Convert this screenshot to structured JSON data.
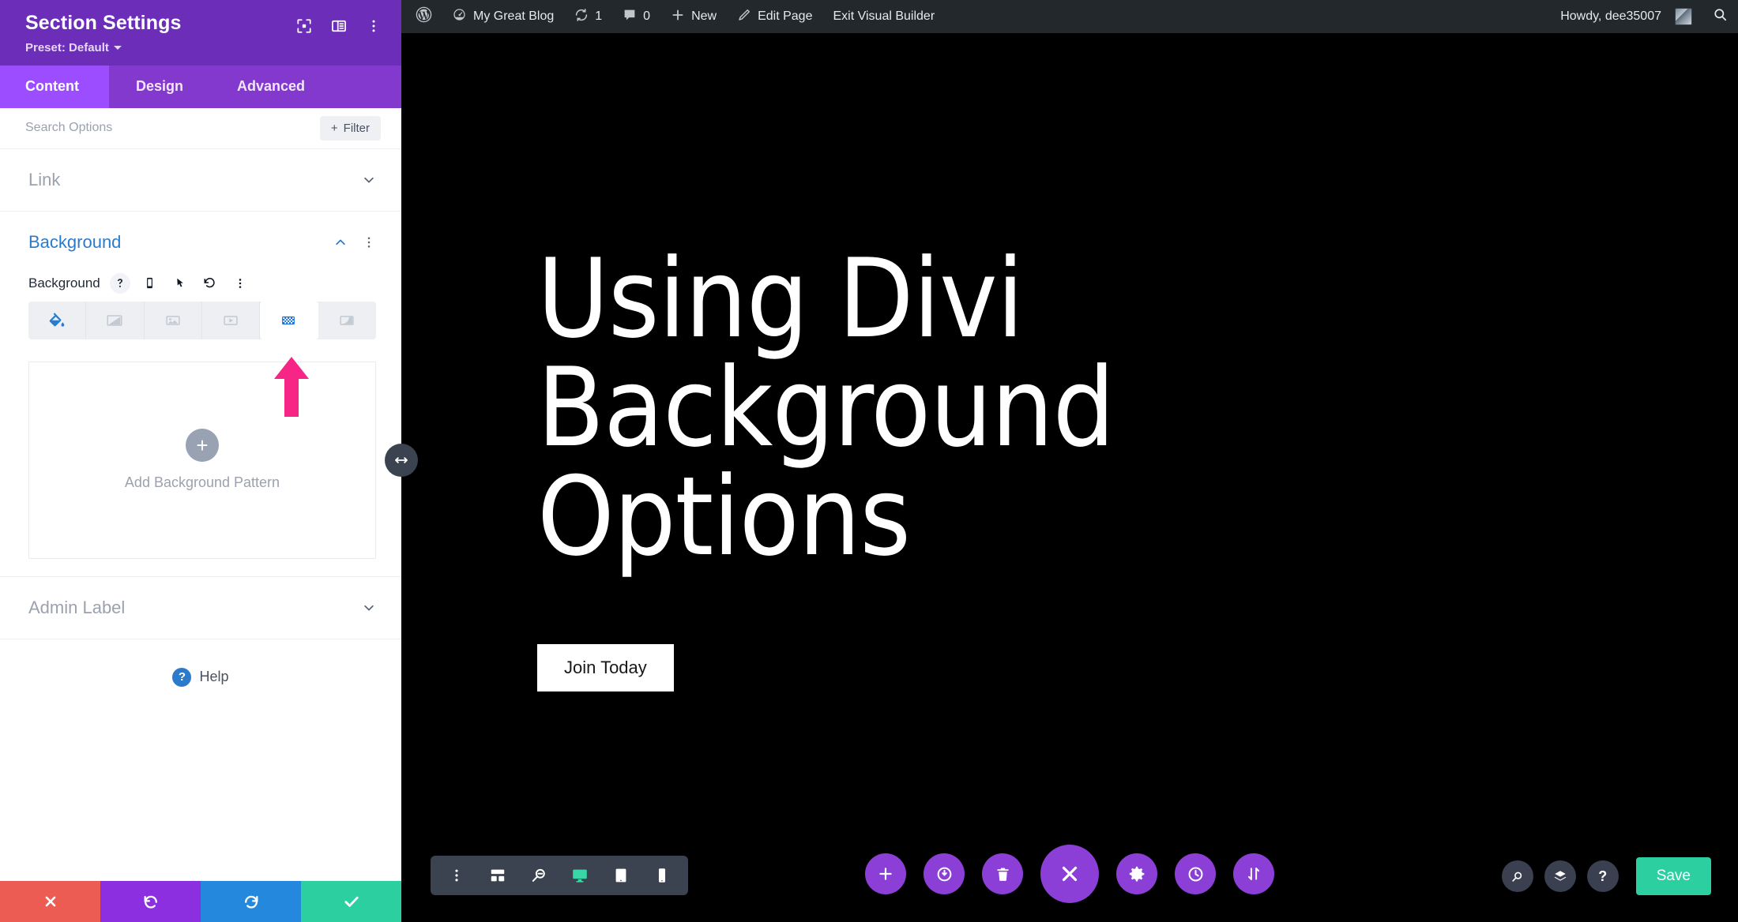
{
  "settings_panel": {
    "title": "Section Settings",
    "preset_label": "Preset: Default",
    "header_icons": [
      {
        "name": "focus-icon",
        "label": "Focus"
      },
      {
        "name": "layout-panel-icon",
        "label": "Panel Layout"
      },
      {
        "name": "more-vertical-icon",
        "label": "More Options"
      }
    ],
    "tabs": [
      {
        "label": "Content",
        "active": true
      },
      {
        "label": "Design",
        "active": false
      },
      {
        "label": "Advanced",
        "active": false
      }
    ],
    "search": {
      "placeholder": "Search Options",
      "value": ""
    },
    "filter_button": "Filter",
    "groups": [
      {
        "label": "Link",
        "open": false
      },
      {
        "label": "Background",
        "open": true
      },
      {
        "label": "Admin Label",
        "open": false
      }
    ],
    "background_field": {
      "label": "Background",
      "control_icons": [
        "help-icon",
        "mobile-icon",
        "cursor-icon",
        "reset-icon",
        "more-vertical-icon"
      ],
      "types": [
        {
          "name": "background-color-icon",
          "label": "Background Color",
          "active": false,
          "highlighted": true
        },
        {
          "name": "background-gradient-icon",
          "label": "Background Gradient",
          "active": false,
          "highlighted": false
        },
        {
          "name": "background-image-icon",
          "label": "Background Image",
          "active": false,
          "highlighted": false
        },
        {
          "name": "background-video-icon",
          "label": "Background Video",
          "active": false,
          "highlighted": false
        },
        {
          "name": "background-pattern-icon",
          "label": "Background Pattern",
          "active": true,
          "highlighted": false
        },
        {
          "name": "background-mask-icon",
          "label": "Background Mask",
          "active": false,
          "highlighted": false
        }
      ],
      "dropzone_label": "Add Background Pattern"
    },
    "help": {
      "label": "Help"
    },
    "actions": [
      {
        "name": "cancel-button",
        "icon": "close-icon",
        "color": "#EC5C52"
      },
      {
        "name": "undo-button",
        "icon": "undo-icon",
        "color": "#8B2FE0"
      },
      {
        "name": "redo-button",
        "icon": "redo-icon",
        "color": "#2489DC"
      },
      {
        "name": "save-changes-button",
        "icon": "check-icon",
        "color": "#2CCFA0"
      }
    ]
  },
  "admin_bar": {
    "site_name": "My Great Blog",
    "updates_count": "1",
    "comments_count": "0",
    "new_label": "New",
    "edit_page_label": "Edit Page",
    "exit_builder_label": "Exit Visual Builder",
    "greeting": "Howdy, dee35007"
  },
  "canvas": {
    "heading": "Using Divi Background Options",
    "cta_button": "Join Today"
  },
  "builder_bar": {
    "left_tools": [
      {
        "name": "more-vertical-icon",
        "label": "More"
      },
      {
        "name": "wireframe-icon",
        "label": "Wireframe View"
      },
      {
        "name": "zoom-out-icon",
        "label": "Zoom Out View"
      },
      {
        "name": "desktop-icon",
        "label": "Desktop View",
        "active": true
      },
      {
        "name": "tablet-icon",
        "label": "Tablet View",
        "active": false
      },
      {
        "name": "phone-icon",
        "label": "Phone View",
        "active": false
      }
    ],
    "center_tools": [
      {
        "name": "add-section-button",
        "icon": "plus-icon",
        "big": false
      },
      {
        "name": "toggle-builder-button",
        "icon": "power-icon",
        "big": false
      },
      {
        "name": "delete-button",
        "icon": "trash-icon",
        "big": false
      },
      {
        "name": "close-menu-button",
        "icon": "close-icon",
        "big": true
      },
      {
        "name": "settings-button",
        "icon": "gear-icon",
        "big": false
      },
      {
        "name": "history-button",
        "icon": "clock-icon",
        "big": false
      },
      {
        "name": "portability-button",
        "icon": "sort-arrows-icon",
        "big": false
      }
    ],
    "right_tools": [
      {
        "name": "search-button",
        "icon": "magnifier-icon"
      },
      {
        "name": "layers-button",
        "icon": "layers-icon"
      },
      {
        "name": "help-button",
        "icon": "question-icon"
      }
    ],
    "save_label": "Save"
  },
  "colors": {
    "panel_header": "#6C2EB9",
    "tab_bar": "#8338CE",
    "tab_active": "#9B4DFF",
    "accent_blue": "#2C7BCB",
    "pointer_arrow": "#F72585",
    "save_green": "#2CCFA0",
    "admin_bar": "#23282D",
    "canvas_bg": "#000000"
  }
}
